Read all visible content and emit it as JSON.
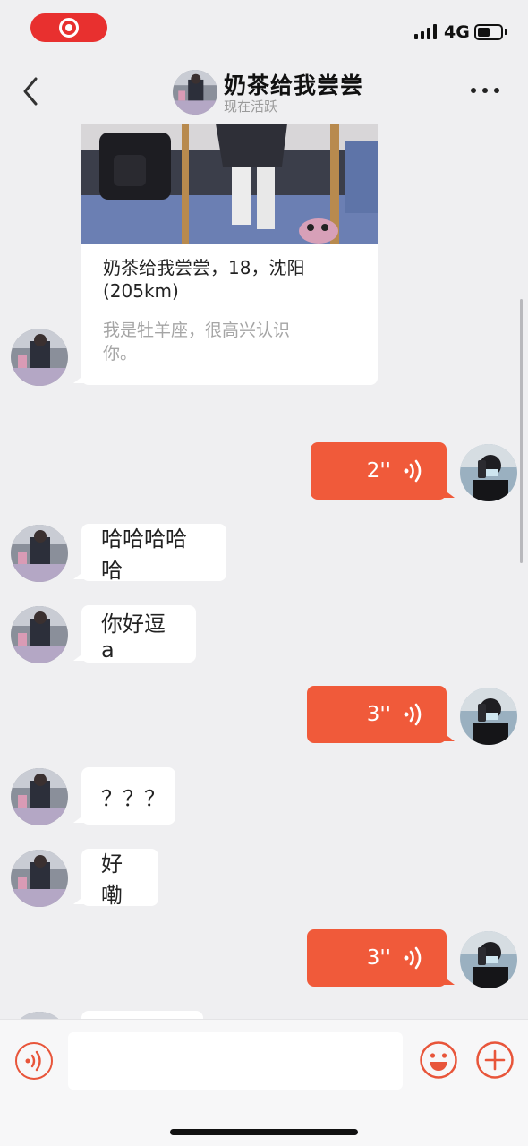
{
  "status_bar": {
    "network": "4G",
    "battery_level": 0.55,
    "record_color": "#e8302f"
  },
  "header": {
    "title": "奶茶给我尝尝",
    "status": "现在活跃",
    "back_icon": "chevron-left-icon",
    "more_icon": "more-dots-icon"
  },
  "profile_card": {
    "title": "奶茶给我尝尝，18，沈阳(205km)",
    "description": "我是牡羊座，很高兴认识你。"
  },
  "messages": [
    {
      "direction": "out",
      "type": "voice",
      "duration": "2''"
    },
    {
      "direction": "in",
      "type": "text",
      "text": "哈哈哈哈哈"
    },
    {
      "direction": "in",
      "type": "text",
      "text": "你好逗a"
    },
    {
      "direction": "out",
      "type": "voice",
      "duration": "3''"
    },
    {
      "direction": "in",
      "type": "text",
      "text": "？？？"
    },
    {
      "direction": "in",
      "type": "text",
      "text": "好嘞"
    },
    {
      "direction": "out",
      "type": "voice",
      "duration": "3''"
    }
  ],
  "input_bar": {
    "placeholder": "",
    "voice_icon": "voice-wave-icon",
    "emoji_icon": "smiley-icon",
    "plus_icon": "plus-circle-icon"
  },
  "colors": {
    "accent": "#f05a3a",
    "background": "#efeff1",
    "bubble_in": "#ffffff"
  }
}
